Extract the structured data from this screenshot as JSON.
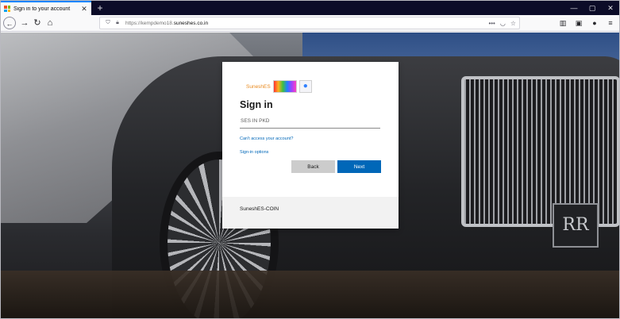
{
  "browser": {
    "tab_title": "Sign in to your account",
    "tab_close": "✕",
    "new_tab": "+",
    "url_prefix": "https://kempdemo18.",
    "url_host": "suneshes.co.in",
    "window_controls": [
      "—",
      "🗗",
      "✕"
    ]
  },
  "signin": {
    "brand_name": "SuneshES",
    "title": "Sign in",
    "account_value": "SES IN PKD",
    "cant_access_link": "Can't access your account?",
    "signin_options_link": "Sign-in options",
    "back_label": "Back",
    "next_label": "Next",
    "footer_text": "SuneshES-COIN"
  },
  "background": {
    "plate_text": "RR"
  },
  "colors": {
    "accent": "#0067b8",
    "tab_highlight": "#0a84ff",
    "brand_orange": "#e98a1f"
  }
}
